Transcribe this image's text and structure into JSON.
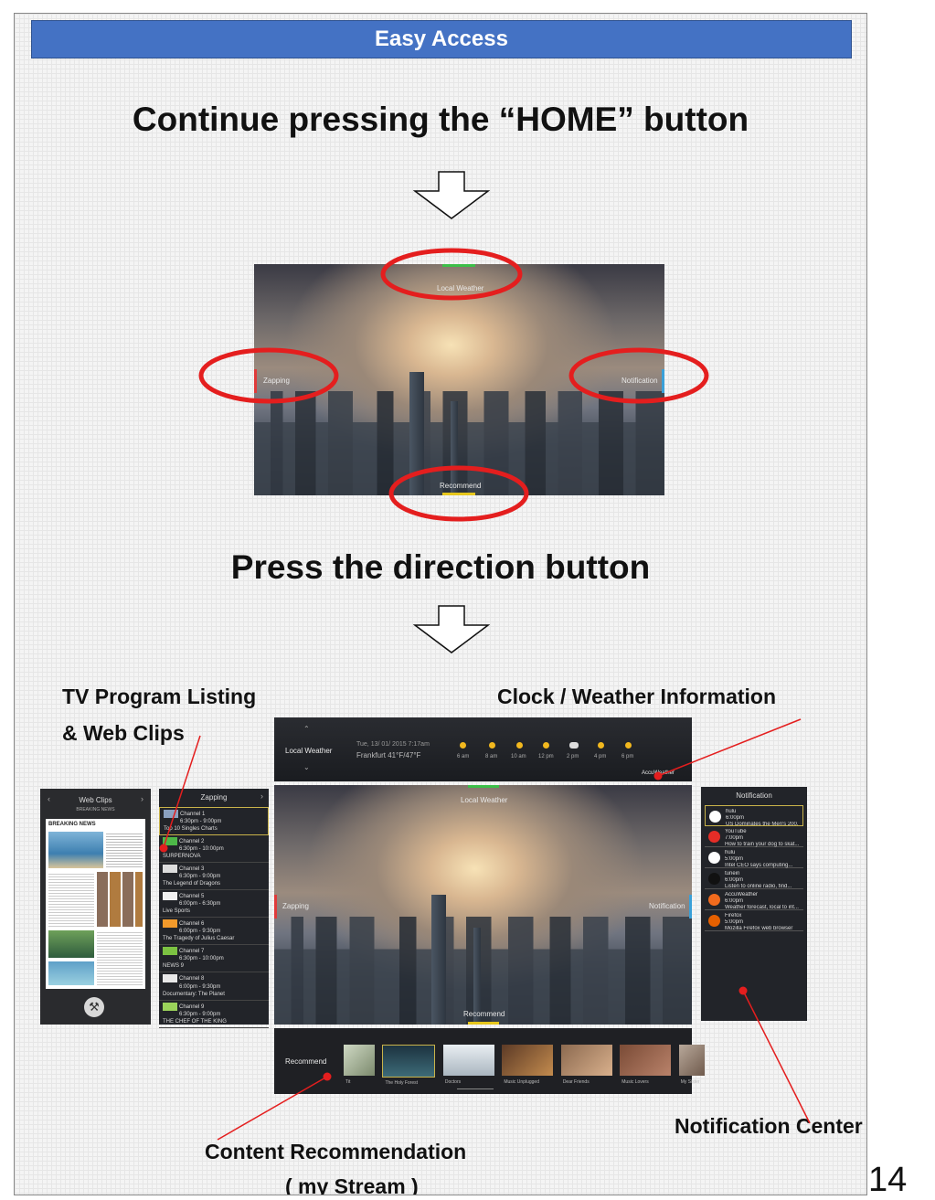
{
  "banner": {
    "title": "Easy Access"
  },
  "step1": {
    "text": "Continue pressing the “HOME” button"
  },
  "step2": {
    "text": "Press the direction button"
  },
  "tv_screen": {
    "top": "Local Weather",
    "left": "Zapping",
    "right": "Notification",
    "bottom": "Recommend",
    "colors": {
      "top": "#3cbf49",
      "left": "#e03a3a",
      "right": "#3aa0d8",
      "bottom": "#e6c61c"
    }
  },
  "labels": {
    "program_listing_line1": "TV Program Listing",
    "program_listing_line2": "& Web Clips",
    "clock_weather": "Clock / Weather Information",
    "notification_center": "Notification Center",
    "recommendation_line1": "Content Recommendation",
    "recommendation_line2": "( my Stream )"
  },
  "weather_bar": {
    "title": "Local Weather",
    "datetime": "Tue, 13/ 01/ 2015  7:17am",
    "location": "Frankfurt  41°F/47°F",
    "times": [
      "6 am",
      "8 am",
      "10 am",
      "12 pm",
      "2 pm",
      "4 pm",
      "6 pm"
    ],
    "brand": "AccuWeather"
  },
  "web_clips": {
    "title": "Web Clips",
    "subtitle": "BREAKING NEWS",
    "headline": "BREAKING NEWS"
  },
  "zapping": {
    "title": "Zapping",
    "rows": [
      {
        "channel": "Channel 1",
        "time": "6:30pm - 9:00pm",
        "show": "Top 10 Singles Charts"
      },
      {
        "channel": "Channel 2",
        "time": "6:30pm - 10:00pm",
        "show": "SURPERNOVA"
      },
      {
        "channel": "Channel 3",
        "time": "6:30pm - 9:00pm",
        "show": "The Legend of Dragons"
      },
      {
        "channel": "Channel 5",
        "time": "6:00pm - 6:30pm",
        "show": "Live Sports"
      },
      {
        "channel": "Channel 6",
        "time": "6:00pm - 9:30pm",
        "show": "The Tragedy of Julius Caesar"
      },
      {
        "channel": "Channel 7",
        "time": "6:30pm - 10:00pm",
        "show": "NEWS 9"
      },
      {
        "channel": "Channel 8",
        "time": "6:00pm - 9:30pm",
        "show": "Documentary: The Planet"
      },
      {
        "channel": "Channel 9",
        "time": "6:30pm - 9:00pm",
        "show": "THE CHEF OF THE KING"
      }
    ]
  },
  "notification": {
    "title": "Notification",
    "items": [
      {
        "app": "hulu",
        "time": "6:00pm",
        "text": "US Dominates the Men's 200...",
        "color": "#ffffff"
      },
      {
        "app": "YouTube",
        "time": "7:00pm",
        "text": "How to train your dog to skat...",
        "color": "#e52d27"
      },
      {
        "app": "hulu",
        "time": "5:00pm",
        "text": "Intel CEO says computing...",
        "color": "#ffffff"
      },
      {
        "app": "tunein",
        "time": "6:00pm",
        "text": "Listen to online radio, find...",
        "color": "#111111"
      },
      {
        "app": "AccuWeather",
        "time": "6:00pm",
        "text": "Weather forecast, local to int...",
        "color": "#f26b1d"
      },
      {
        "app": "Firefox",
        "time": "5:00pm",
        "text": "Mozilla Firefox web browser",
        "color": "#e66000"
      }
    ]
  },
  "recommend_bar": {
    "title": "Recommend",
    "items": [
      "Tit",
      "The Holy Forest",
      "Doctors",
      "Music Unplugged",
      "Dear Friends",
      "Music Lovers",
      "My Sister"
    ]
  },
  "page_number": "14"
}
